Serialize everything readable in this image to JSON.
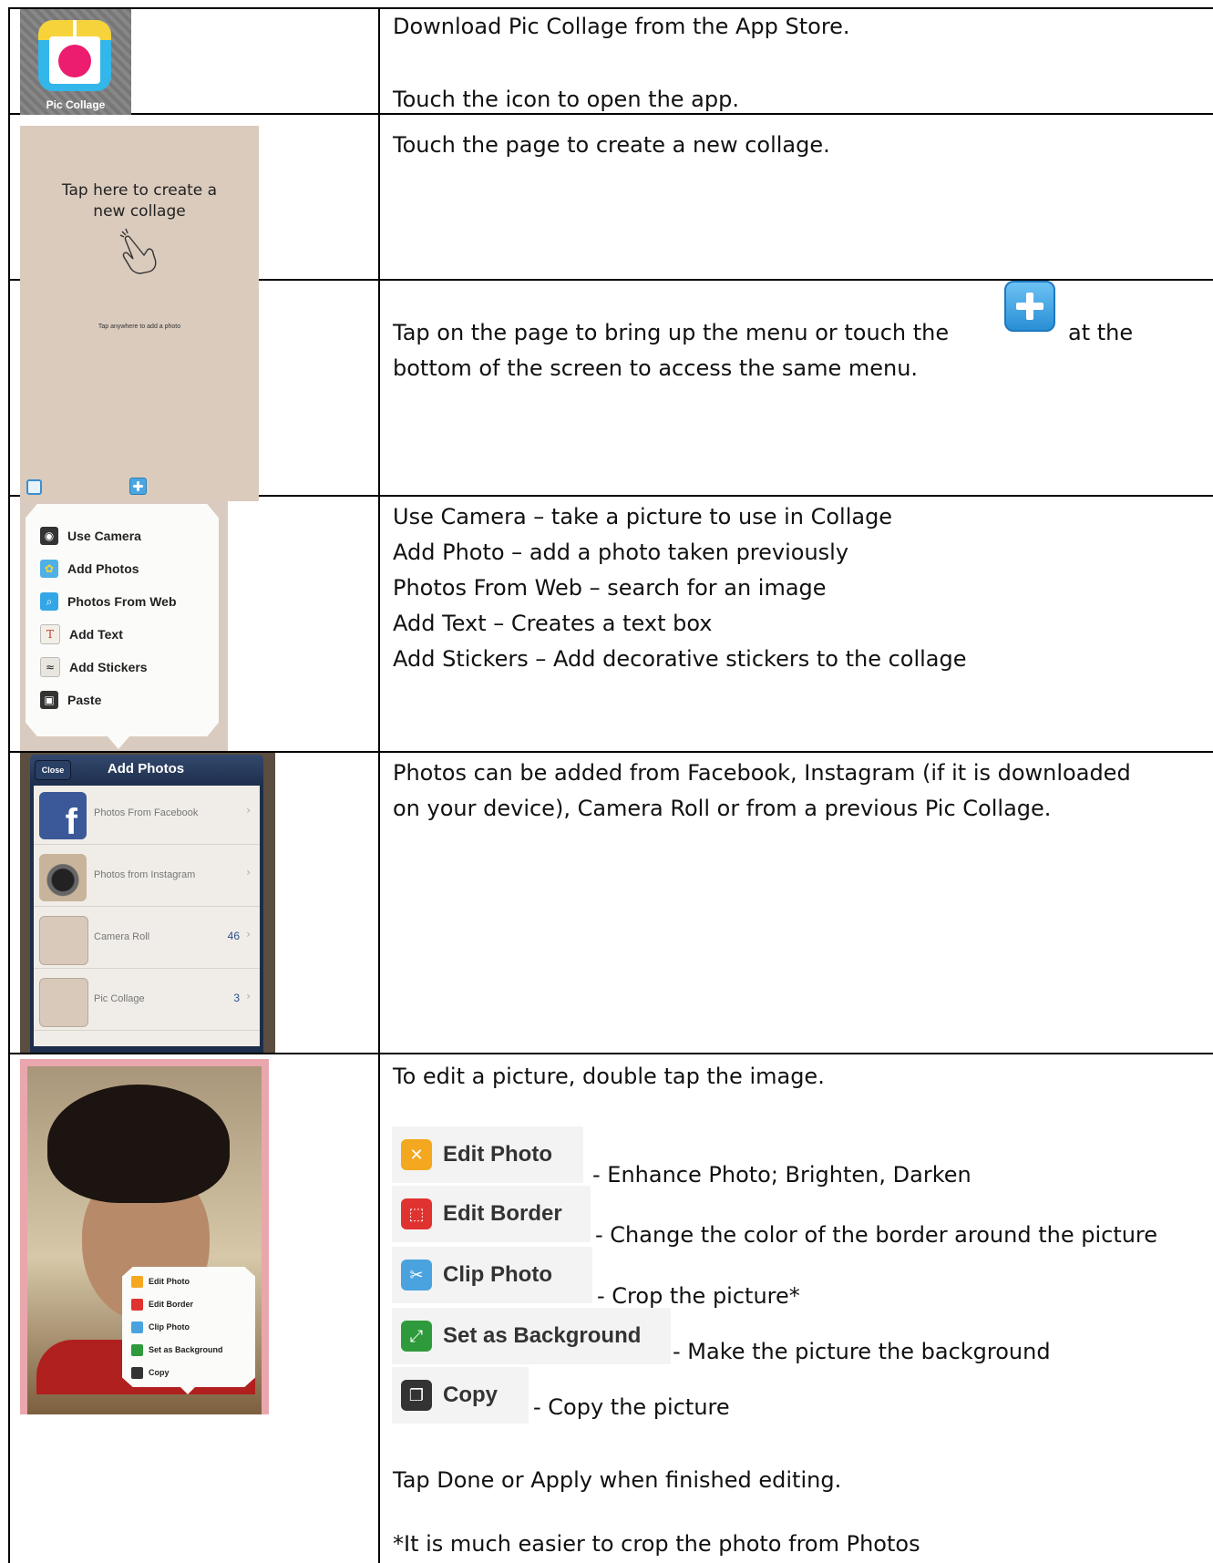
{
  "rows": [
    {
      "lines": [
        "Download Pic Collage from the App Store.",
        "Touch the icon to open the app."
      ],
      "app_label": "Pic Collage"
    },
    {
      "lines": [
        "Touch the page to create a new collage."
      ],
      "screen_title_1": "Tap here to create a",
      "screen_title_2": "new collage"
    },
    {
      "line1_pre": "Tap on the page to bring up the menu or touch the",
      "line1_post": "at the",
      "line2": "bottom of the screen to access the same menu.",
      "screen_hint": "Tap anywhere to add a photo"
    },
    {
      "lines": [
        "Use Camera – take a picture to use in Collage",
        "Add Photo – add a photo taken previously",
        "Photos From Web – search for an image",
        "Add Text – Creates a text box",
        "Add Stickers – Add decorative stickers to the collage"
      ],
      "menu": [
        "Use Camera",
        "Add Photos",
        "Photos From Web",
        "Add Text",
        "Add Stickers",
        "Paste"
      ]
    },
    {
      "lines": [
        "Photos can be added from Facebook, Instagram (if it is downloaded",
        "on your device), Camera Roll or from a previous Pic Collage."
      ],
      "panel_title": "Add Photos",
      "close_label": "Close",
      "sources": [
        {
          "label": "Photos From Facebook",
          "count": ""
        },
        {
          "label": "Photos from Instagram",
          "count": ""
        },
        {
          "label": "Camera Roll",
          "count": "46"
        },
        {
          "label": "Pic Collage",
          "count": "3"
        }
      ]
    },
    {
      "intro": "To edit a picture, double tap the image.",
      "actions": [
        {
          "label": "Edit Photo",
          "desc": "- Enhance Photo; Brighten, Darken",
          "color": "#f3a81f"
        },
        {
          "label": "Edit Border",
          "desc": "- Change the color of the border around the picture",
          "color": "#e0322f"
        },
        {
          "label": "Clip Photo",
          "desc": "- Crop the picture*",
          "color": "#4aa3df"
        },
        {
          "label": "Set as Background",
          "desc": "- Make the picture the background",
          "color": "#2f9a3b"
        },
        {
          "label": "Copy",
          "desc": "- Copy the picture",
          "color": "#333333"
        }
      ],
      "popup": [
        "Edit Photo",
        "Edit Border",
        "Clip Photo",
        "Set as Background",
        "Copy"
      ],
      "done": "Tap Done or Apply when finished editing.",
      "note": "*It is much easier to crop the photo from Photos"
    }
  ],
  "colors": {
    "paper": "#dacbbd",
    "plus_button": "#2a8fd5",
    "popup": "#fbfbf9"
  }
}
